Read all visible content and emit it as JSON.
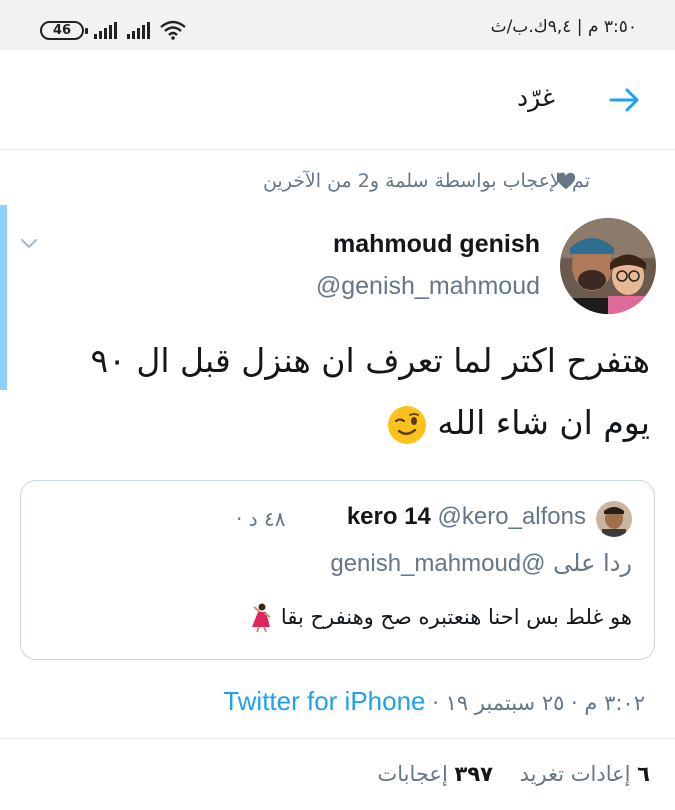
{
  "status_bar": {
    "battery": "46",
    "time_info": "٣:٥٠ م | ٩,٤ك.ب/ث"
  },
  "header": {
    "title": "غرّد",
    "back_icon": "arrow-right-icon"
  },
  "social_context": {
    "text": "تم الإعجاب بواسطة سلمة و2 من الآخرين",
    "icon": "heart-icon"
  },
  "tweet": {
    "author_name": "mahmoud genish",
    "author_handle": "@genish_mahmoud",
    "text_line1": "هتفرح اكتر لما تعرف ان هنزل قبل ال ٩٠",
    "text_line2": "يوم ان شاء الله",
    "emoji": "winking-face-emoji",
    "quoted": {
      "name": "kero 14",
      "handle": "@kero_alfons",
      "time": "٤٨ د",
      "reply_prefix": "ردا على",
      "reply_handle": "@genish_mahmoud",
      "text": "هو غلط بس احنا هنعتبره صح وهنفرح بقا",
      "emoji": "dancer-emoji"
    },
    "timestamp": "٣:٠٢ م · ٢٥ سبتمبر ١٩",
    "separator": "·",
    "source": "Twitter for iPhone",
    "retweets_count": "٦",
    "retweets_label": "إعادات تغريد",
    "likes_count": "٣٩٧",
    "likes_label": "إعجابات"
  },
  "colors": {
    "accent": "#1da1f2",
    "secondary_text": "#657786",
    "thread_bar": "#8ed0f9"
  }
}
